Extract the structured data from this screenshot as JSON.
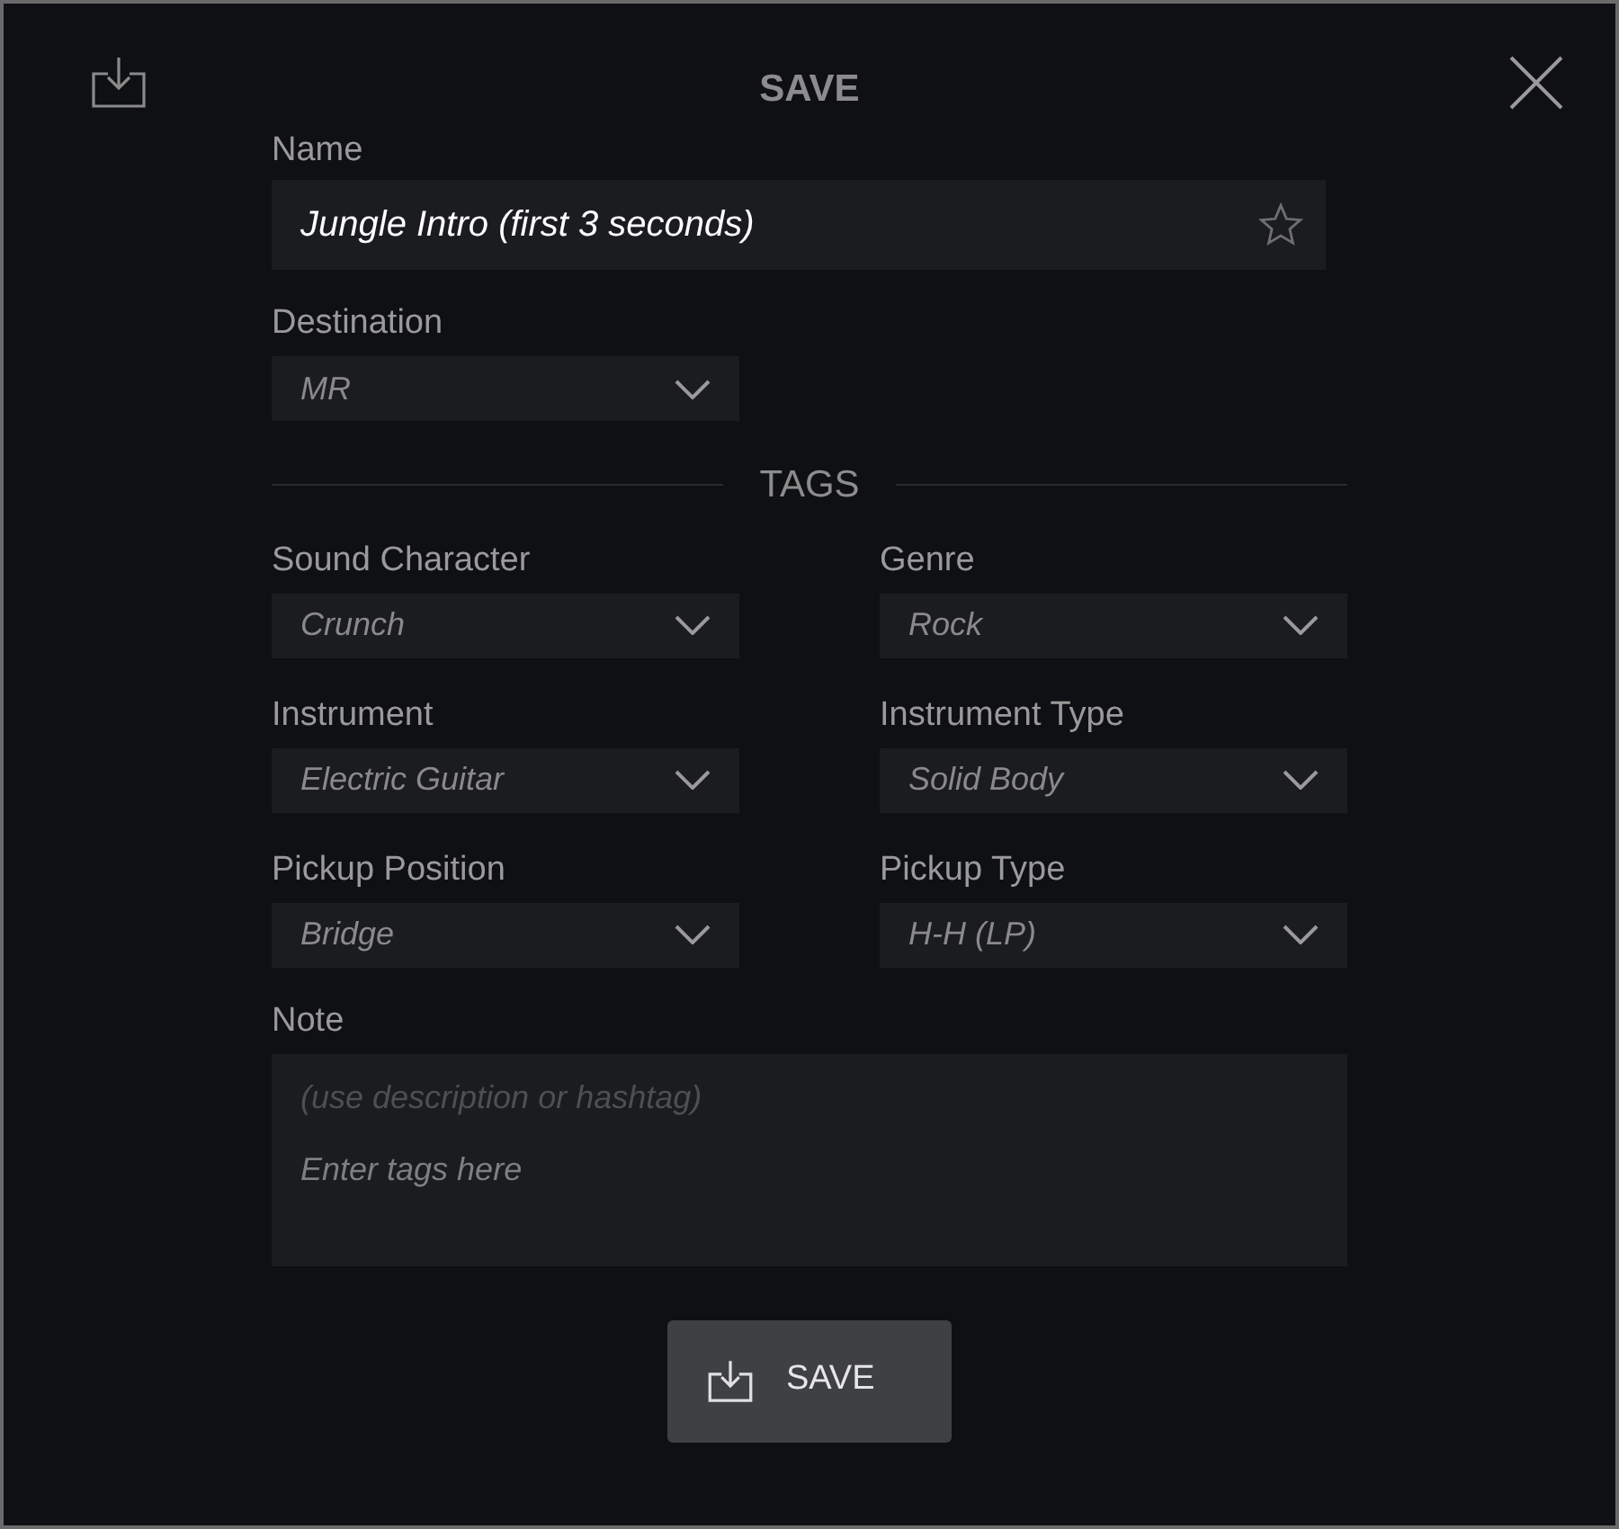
{
  "dialog": {
    "title": "SAVE"
  },
  "name": {
    "label": "Name",
    "value": "Jungle Intro (first 3 seconds)",
    "favorite": false
  },
  "destination": {
    "label": "Destination",
    "value": "MR"
  },
  "tags": {
    "heading": "TAGS",
    "fields": [
      {
        "label": "Sound Character",
        "value": "Crunch"
      },
      {
        "label": "Genre",
        "value": "Rock"
      },
      {
        "label": "Instrument",
        "value": "Electric Guitar"
      },
      {
        "label": "Instrument Type",
        "value": "Solid Body"
      },
      {
        "label": "Pickup Position",
        "value": "Bridge"
      },
      {
        "label": "Pickup Type",
        "value": "H-H (LP)"
      }
    ]
  },
  "note": {
    "label": "Note",
    "hint": "(use description or hashtag)",
    "placeholder": "Enter tags here"
  },
  "save_button": {
    "label": "SAVE"
  }
}
